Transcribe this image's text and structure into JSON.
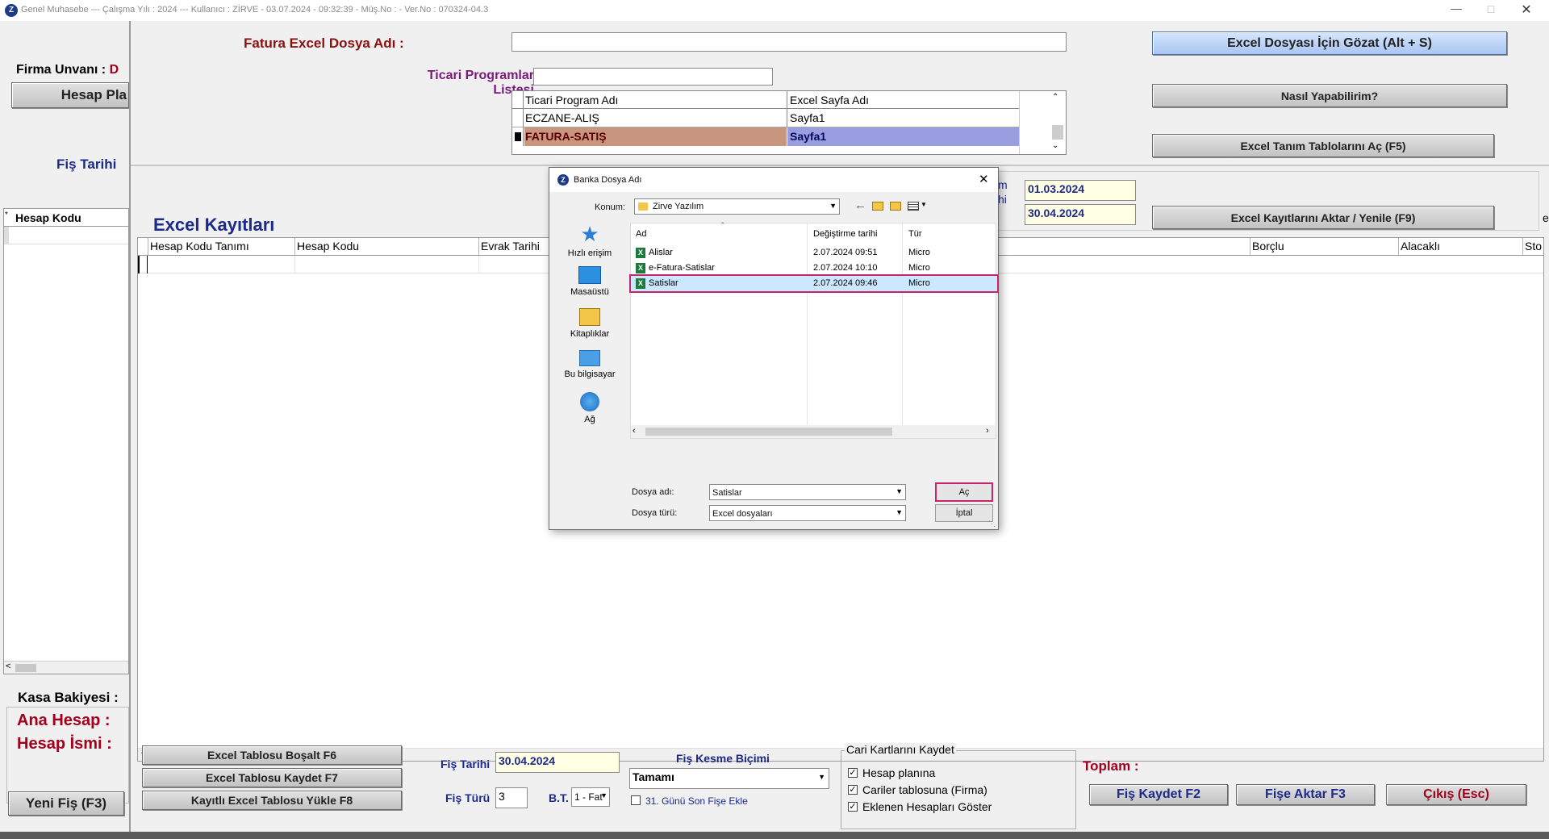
{
  "titlebar": {
    "app_logo": "Z",
    "title": "Genel Muhasebe  ---  Çalışma Yılı : 2024  ---  Kullanıcı : ZİRVE - 03.07.2024 - 09:32:39 - Müş.No :  - Ver.No : 070324-04.3"
  },
  "left": {
    "firma_label": "Firma Unvanı :",
    "firma_value": "D",
    "hesap_button": "Hesap Pla",
    "fis_tarihi": "Fiş Tarihi",
    "grid_header": "Hesap Kodu",
    "kasa": "Kasa Bakiyesi :",
    "ana_hesap": "Ana Hesap :",
    "hesap_ismi": "Hesap İsmi :",
    "yeni_fis": "Yeni Fiş (F3)"
  },
  "top": {
    "fatura_label": "Fatura Excel Dosya Adı :",
    "fatura_value": "",
    "browse_button": "Excel Dosyası İçin Gözat (Alt + S)",
    "ticari_label_1": "Ticari Programlar",
    "ticari_label_2": "Listesi",
    "nasil_button": "Nasıl Yapabilirim?",
    "tanim_button": "Excel Tanım Tablolarını Aç (F5)",
    "program_table": {
      "headers": [
        "Ticari Program Adı",
        "Excel Sayfa Adı"
      ],
      "rows": [
        {
          "program": "ECZANE-ALIŞ",
          "sheet": "Sayfa1",
          "selected": false
        },
        {
          "program": "FATURA-SATIŞ",
          "sheet": "Sayfa1",
          "selected": true
        }
      ]
    }
  },
  "dates": {
    "label_partial_1": "m",
    "label_partial_2": "hi",
    "start": "01.03.2024",
    "end": "30.04.2024",
    "aktar_button": "Excel Kayıtlarını Aktar / Yenile (F9)",
    "edge_char": "e"
  },
  "excel": {
    "title": "Excel Kayıtları",
    "columns": [
      "Hesap Kodu Tanımı",
      "Hesap Kodu",
      "Evrak Tarihi",
      "Borçlu",
      "Alacaklı",
      "Sto"
    ]
  },
  "bottom": {
    "bosalt": "Excel Tablosu Boşalt F6",
    "kaydet": "Excel Tablosu Kaydet F7",
    "yukle": "Kayıtlı Excel Tablosu Yükle F8",
    "fis_tarihi_label": "Fiş Tarihi",
    "fis_tarihi_value": "30.04.2024",
    "fis_turu_label": "Fiş Türü",
    "fis_turu_value": "3",
    "bt_label": "B.T.",
    "bt_value": "1 - Fat",
    "kesme_label": "Fiş Kesme Biçimi",
    "kesme_value": "Tamamı",
    "son_gun": "31. Günü Son Fişe Ekle",
    "cari_group": "Cari Kartlarını Kaydet",
    "cb1": "Hesap planına",
    "cb2": "Cariler tablosuna (Firma)",
    "cb3": "Eklenen Hesapları Göster",
    "toplam": "Toplam :",
    "fis_kaydet": "Fiş Kaydet F2",
    "fise_aktar": "Fişe Aktar F3",
    "cikis": "Çıkış (Esc)"
  },
  "dialog": {
    "title": "Banka Dosya Adı",
    "konum_label": "Konum:",
    "konum_value": "Zirve Yazılım",
    "nav": [
      "Hızlı erişim",
      "Masaüstü",
      "Kitaplıklar",
      "Bu bilgisayar",
      "Ağ"
    ],
    "columns": [
      "Ad",
      "Değiştirme tarihi",
      "Tür"
    ],
    "files": [
      {
        "name": "Alislar",
        "date": "2.07.2024 09:51",
        "type": "Micro",
        "selected": false
      },
      {
        "name": "e-Fatura-Satislar",
        "date": "2.07.2024 10:10",
        "type": "Micro",
        "selected": false
      },
      {
        "name": "Satislar",
        "date": "2.07.2024 09:46",
        "type": "Micro",
        "selected": true
      }
    ],
    "dosya_adi_label": "Dosya adı:",
    "dosya_adi_value": "Satislar",
    "dosya_turu_label": "Dosya türü:",
    "dosya_turu_value": "Excel dosyaları",
    "ac_button": "Aç",
    "iptal_button": "İptal",
    "colors": {
      "highlight": "#c8246c",
      "selection": "#cce8ff"
    }
  }
}
